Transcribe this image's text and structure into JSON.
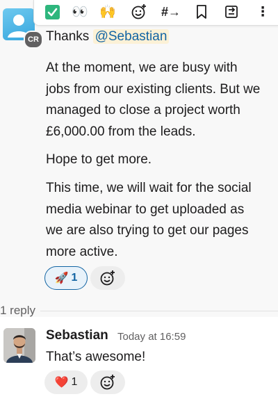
{
  "toolbar": {
    "items": [
      {
        "name": "check-mark-emoji",
        "glyph": "✓"
      },
      {
        "name": "eyes-emoji",
        "glyph": "👀"
      },
      {
        "name": "raised-hands-emoji",
        "glyph": "🙌"
      },
      {
        "name": "add-reaction-icon"
      },
      {
        "name": "reply-in-thread-icon",
        "glyph": "#→"
      },
      {
        "name": "bookmark-icon"
      },
      {
        "name": "forward-icon"
      },
      {
        "name": "more-actions-icon",
        "glyph": "⋮"
      }
    ]
  },
  "message": {
    "avatar_badge": "CR",
    "thanks": "Thanks",
    "mention": "@Sebastian",
    "paragraphs": [
      "At the moment, we are busy with\njobs from our existing clients. But we\nmanaged to close a project worth\n£6,000.00 from the leads.",
      "Hope to get more.",
      "This time, we will wait for the social\nmedia webinar to get uploaded as\nwe are also trying to get our pages\nmore active."
    ],
    "reactions": [
      {
        "emoji": "🚀",
        "count": "1"
      }
    ]
  },
  "thread": {
    "reply_count": "1 reply"
  },
  "reply": {
    "name": "Sebastian",
    "timestamp": "Today at 16:59",
    "text": "That’s awesome!",
    "reactions": [
      {
        "emoji": "❤️",
        "count": "1"
      }
    ]
  }
}
